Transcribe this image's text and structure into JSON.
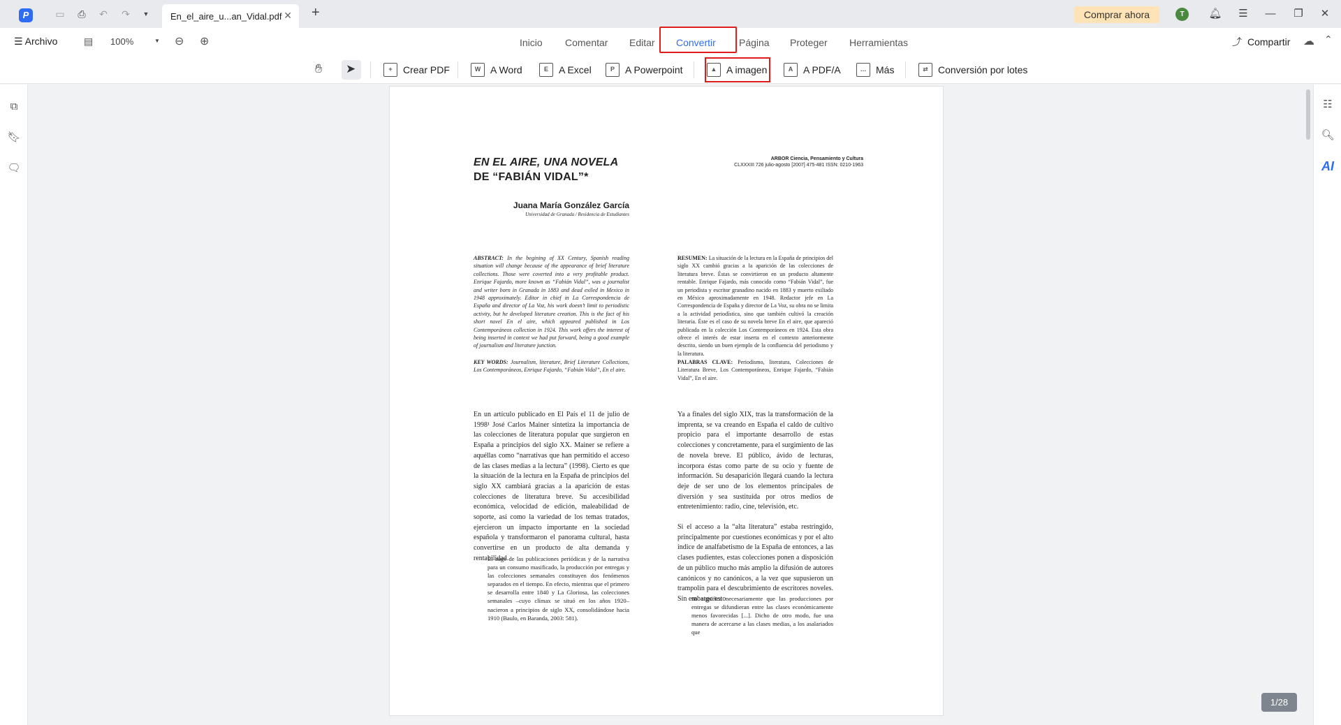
{
  "titlebar": {
    "tab_title": "En_el_aire_u...an_Vidal.pdf",
    "buy_label": "Comprar ahora",
    "avatar_letter": "T"
  },
  "menubar": {
    "archivo": "Archivo",
    "zoom": "100%",
    "tabs": [
      "Inicio",
      "Comentar",
      "Editar",
      "Convertir",
      "Página",
      "Proteger",
      "Herramientas"
    ],
    "share": "Compartir",
    "active_tab": "Convertir"
  },
  "toolbar": {
    "crear_pdf": "Crear PDF",
    "a_word": "A Word",
    "a_excel": "A Excel",
    "a_powerpoint": "A Powerpoint",
    "a_imagen": "A imagen",
    "a_pdfa": "A PDF/A",
    "mas": "Más",
    "lotes": "Conversión por lotes"
  },
  "document": {
    "title_line1": "EN EL AIRE, UNA NOVELA",
    "title_line2": "DE “FABIÁN VIDAL”*",
    "journal_line1": "ARBOR Ciencia, Pensamiento y Cultura",
    "journal_line2": "CLXXXIII 726 julio-agosto [2007] 475-481 ISSN: 0210-1963",
    "author": "Juana María González García",
    "affiliation": "Universidad de Granada / Residencia de Estudiantes",
    "abstract_en_label": "ABSTRACT:",
    "abstract_en": "In the begining of XX Century, Spanish reading situation will change because of the appearance of brief literature collections. Those were coverted into a very profitable product. Enrique Fajardo, more known as “Fabián Vidal”, was a journalist and writer born in Granada in 1883 and dead exiled in Mexico in 1948 approximately. Editor in chief in La Correspondencia de España and director of La Voz, his work doesn’t limit to periodistic activity, but he developed literature creation. This is the fact of his short novel En el aire, which appeared published in Los Contemporáneos collection in 1924. This work offers the interest of being inserted in context we had put forward, being a good example of journalism and literature junction.",
    "abstract_es_label": "RESUMEN:",
    "abstract_es": "La situación de la lectura en la España de principios del siglo XX cambió gracias a la aparición de las colecciones de literatura breve. Éstas se convirtieron en un producto altamente rentable. Enrique Fajardo, más conocido como “Fabián Vidal”, fue un periodista y escritor granadino nacido en 1883 y muerto exiliado en México aproximadamente en 1948. Redactor jefe en La Correspondencia de España y director de La Voz, su obra no se limita a la actividad periodística, sino que también cultivó la creación literaria. Éste es el caso de su novela breve En el aire, que apareció publicada en la colección Los Contemporáneos en 1924. Esta obra ofrece el interés de estar inserta en el contexto anteriormente descrito, siendo un buen ejemplo de la confluencia del periodismo y la literatura.",
    "keywords_en_label": "KEY WORDS:",
    "keywords_en": "Journalism, literature, Brief Literature Collections, Los Contemporáneos, Enrique Fajardo, “Fabián Vidal”, En el aire.",
    "keywords_es_label": "PALABRAS CLAVE:",
    "keywords_es": "Periodismo, literatura, Colecciones de Literatura Breve, Los Contemporáneos, Enrique Fajardo, “Fabián Vidal”, En el aire.",
    "body_left": "En un artículo publicado en El País el 11 de julio de 1998¹ José Carlos Mainer sintetiza la importancia de las colecciones de literatura popular que surgieron en España a principios del siglo XX. Mainer se refiere a aquéllas como “narrativas que han permitido el acceso de las clases medias a la lectura” (1998). Cierto es que la situación de la lectura en la España de principios del siglo XX cambiará gracias a la aparición de estas colecciones de literatura breve. Su accesibilidad económica, velocidad de edición, maleabilidad de soporte, así como la variedad de los temas tratados, ejercieron un impacto importante en la sociedad española y transformaron el panorama cultural, hasta convertirse en un producto de alta demanda y rentabilidad.",
    "quote_left": "El auge de las publicaciones periódicas y de la narrativa para un consumo masificado, la producción por entregas y las colecciones semanales constituyen dos fenómenos separados en el tiempo. En efecto, mientras que el primero se desarrolla entre 1840 y La Gloriosa, las colecciones semanales –cuyo clímax se situó en los años 1920– nacieron a principios de siglo XX, consolidándose hacia 1910 (Baulo, en Baranda, 2003: 581).",
    "body_right_p1": "Ya a finales del siglo XIX, tras la transformación de la imprenta, se va creando en España el caldo de cultivo propicio para el importante desarrollo de estas colecciones y concretamente, para el surgimiento de las de novela breve. El público, ávido de lecturas, incorpora éstas como parte de su ocio y fuente de información. Su desaparición llegará cuando la lectura deje de ser uno de los elementos principales de diversión y sea sustituida por otros medios de entretenimiento: radio, cine, televisión, etc.",
    "body_right_p2": "Si el acceso a la “alta literatura” estaba restringido, principalmente por cuestiones económicas y por el alto índice de analfabetismo de la España de entonces, a las clases pudientes, estas colecciones ponen a disposición de un público mucho más amplio la difusión de autores canónicos y no canónicos, a la vez que supusieron un trampolín para el descubrimiento de escritores noveles. Sin embargo esto",
    "quote_right": "no significa necesariamente que las producciones por entregas se difundieran entre las clases económicamente menos favorecidas [...]. Dicho de otro modo, fue una manera de acercarse a las clases medias, a los asalariados que"
  },
  "page_indicator": "1/28",
  "colors": {
    "accent": "#2e6cf6",
    "highlight_box": "#e01b1b",
    "buy_bg": "#fde3b6",
    "avatar": "#4a8a3e"
  }
}
